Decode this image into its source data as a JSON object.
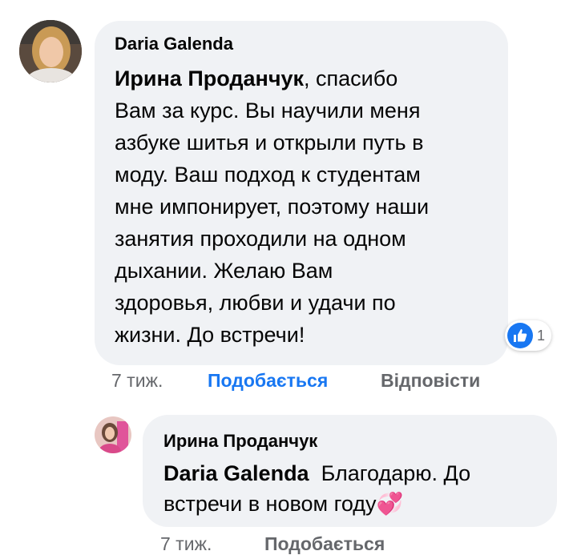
{
  "comment": {
    "author": "Daria Galenda",
    "mention": "Ирина Проданчук",
    "text_lines": [
      ", спасибо",
      "Вам за курс. Вы научили меня",
      "азбуке шитья и открыли путь в",
      "моду. Ваш подход к студентам",
      "мне импонирует, поэтому наши",
      "занятия проходили на одном",
      "дыхании. Желаю Вам",
      "здоровья, любви и удачи по",
      "жизни. До встречи!"
    ],
    "reaction_count": "1",
    "reaction_icon": "like-icon",
    "time": "7 тиж.",
    "like_label": "Подобається",
    "reply_label": "Відповісти"
  },
  "reply": {
    "author": "Ирина Проданчук",
    "mention": "Daria Galenda",
    "text_line1": "Благодарю. До",
    "text_line2": "встречи в новом году",
    "emoji": "💞",
    "time": "7 тиж.",
    "like_label": "Подобається"
  },
  "colors": {
    "bubble": "#f0f2f5",
    "link_blue": "#1877f2",
    "meta_gray": "#65676b"
  }
}
